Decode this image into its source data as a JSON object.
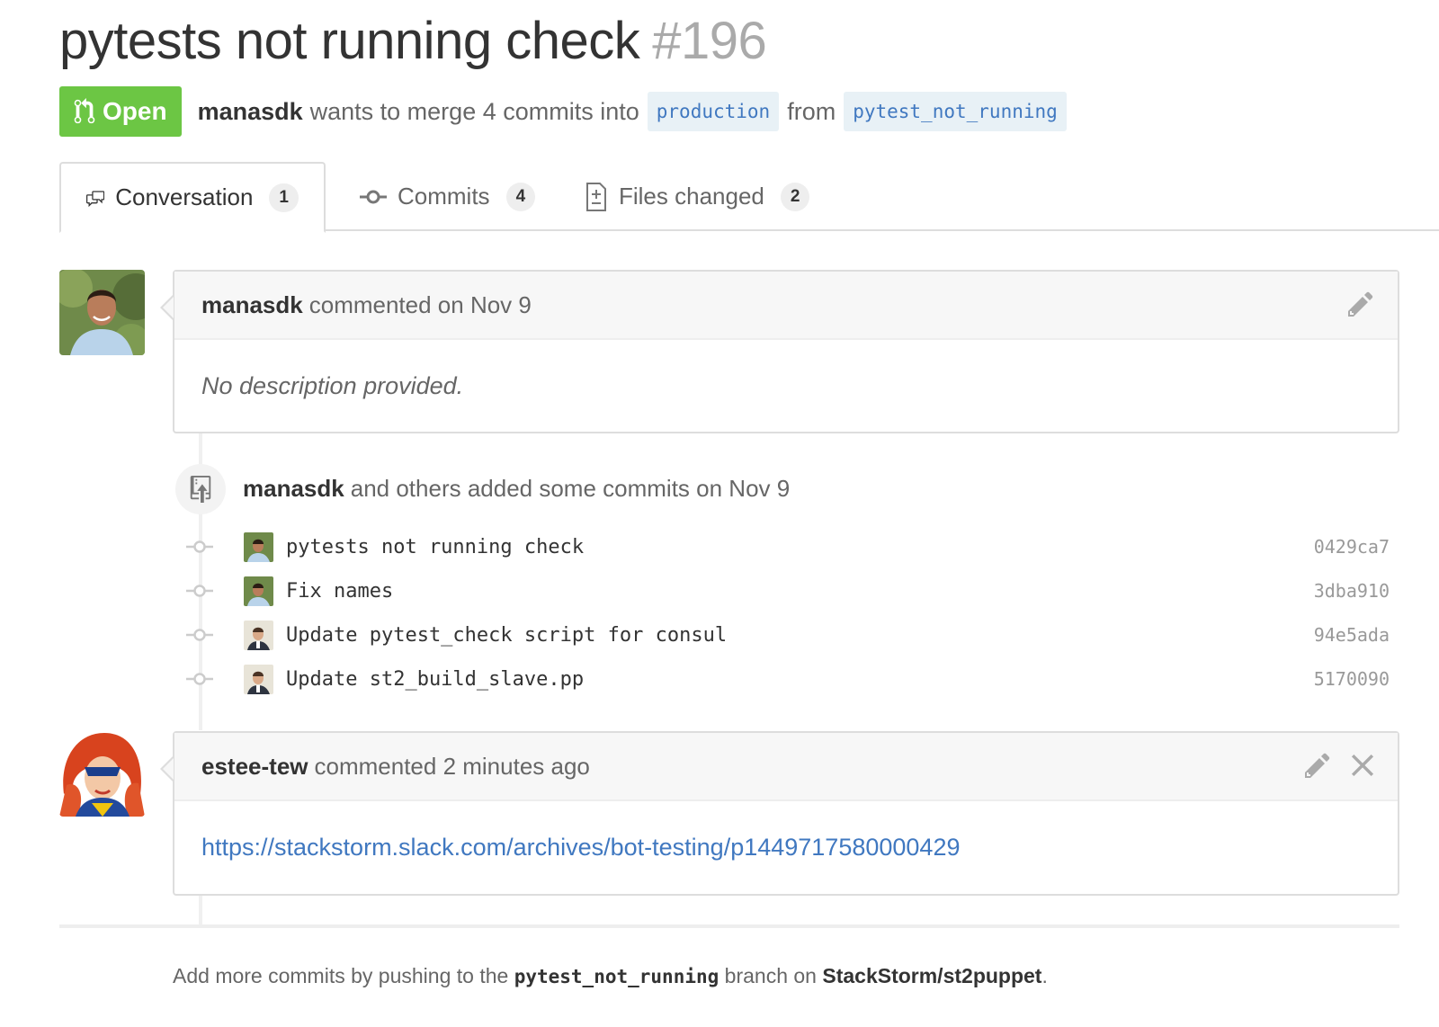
{
  "pr": {
    "title": "pytests not running check",
    "number": "#196",
    "state_label": "Open",
    "author": "manasdk",
    "merge_text_pre": "wants to merge 4 commits into",
    "base_branch": "production",
    "from_text": "from",
    "head_branch": "pytest_not_running"
  },
  "tabs": [
    {
      "label": "Conversation",
      "count": "1",
      "icon": "comment-discussion-icon"
    },
    {
      "label": "Commits",
      "count": "4",
      "icon": "git-commit-icon"
    },
    {
      "label": "Files changed",
      "count": "2",
      "icon": "file-diff-icon"
    }
  ],
  "comments": [
    {
      "author": "manasdk",
      "action": "commented on Nov 9",
      "body": "No description provided."
    },
    {
      "author": "estee-tew",
      "action": "commented 2 minutes ago",
      "body": "https://stackstorm.slack.com/archives/bot-testing/p1449717580000429"
    }
  ],
  "commit_event": {
    "author": "manasdk",
    "text": "and others added some commits on Nov 9"
  },
  "commits": [
    {
      "message": "pytests not running check",
      "sha": "0429ca7"
    },
    {
      "message": "Fix names",
      "sha": "3dba910"
    },
    {
      "message": "Update pytest_check script for consul",
      "sha": "94e5ada"
    },
    {
      "message": "Update st2_build_slave.pp",
      "sha": "5170090"
    }
  ],
  "footer": {
    "pre": "Add more commits by pushing to the",
    "branch": "pytest_not_running",
    "mid": "branch on",
    "repo": "StackStorm/st2puppet",
    "end": "."
  },
  "colors": {
    "open_green": "#6cc644",
    "link_blue": "#4078c0",
    "branch_bg": "#e8f1f6"
  }
}
